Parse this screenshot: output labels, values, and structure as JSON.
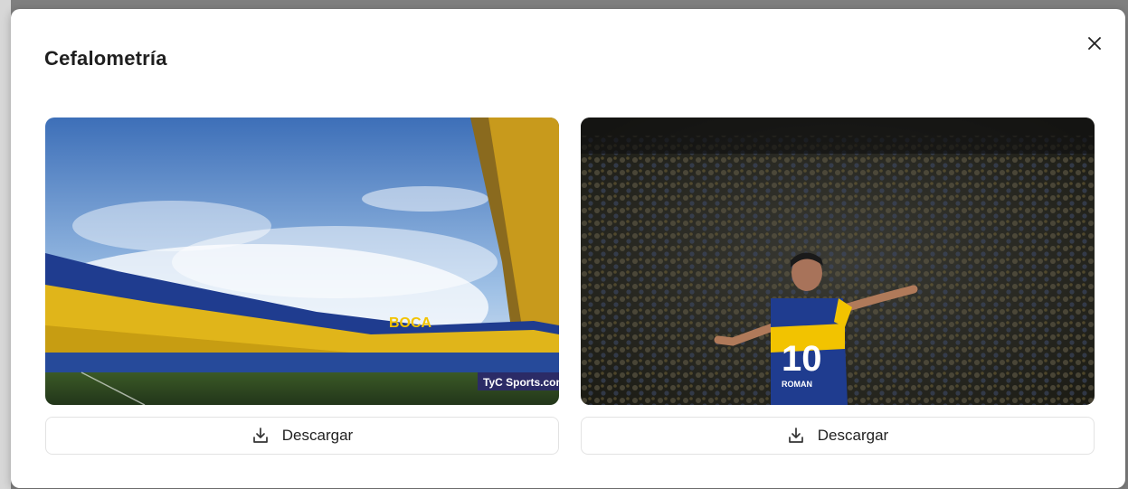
{
  "modal": {
    "title": "Cefalometría",
    "close_icon": "close-icon"
  },
  "images": [
    {
      "icon": "download-icon",
      "download_label": "Descargar",
      "watermark": "TyC Sports.com",
      "stadium_letters": "BOCA"
    },
    {
      "icon": "download-icon",
      "download_label": "Descargar",
      "jersey_number": "10",
      "jersey_name": "ROMAN"
    }
  ],
  "colors": {
    "boca_blue": "#1f3c8f",
    "boca_yellow": "#f2c300",
    "grass": "#2f4a1f"
  }
}
